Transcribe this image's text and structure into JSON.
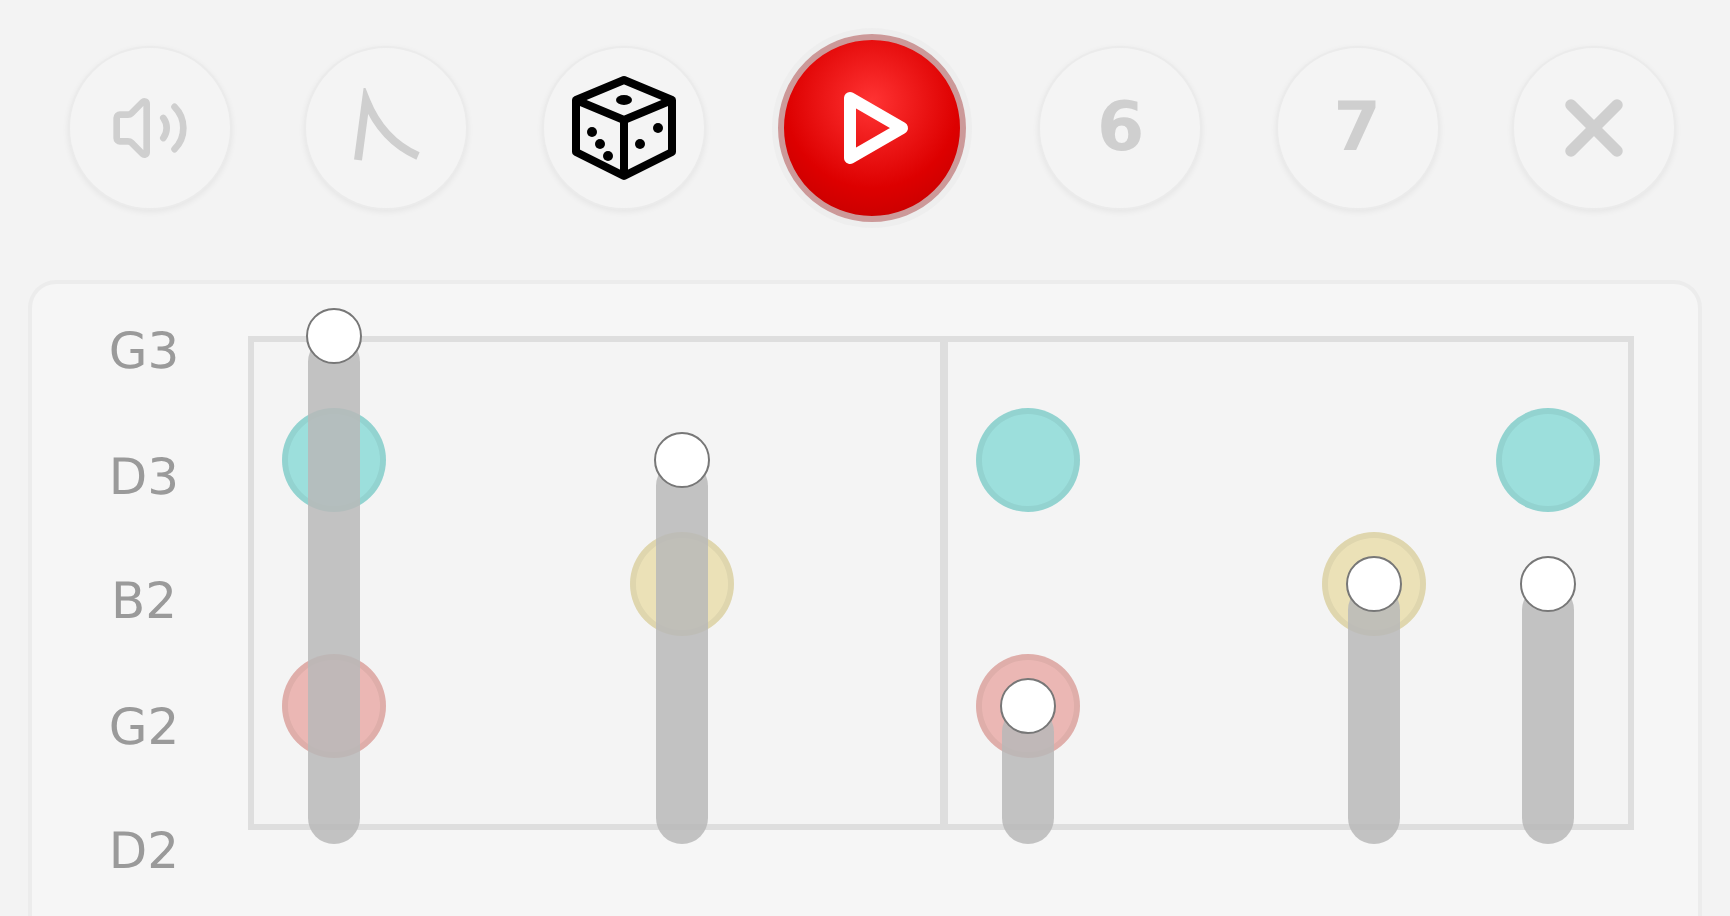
{
  "toolbar": [
    {
      "kind": "sound",
      "disabled": true
    },
    {
      "kind": "decay",
      "disabled": true
    },
    {
      "kind": "dice",
      "disabled": false
    },
    {
      "kind": "play",
      "disabled": false
    },
    {
      "kind": "number",
      "label": "6",
      "disabled": true
    },
    {
      "kind": "number",
      "label": "7",
      "disabled": true
    },
    {
      "kind": "close",
      "disabled": true
    }
  ],
  "grid": {
    "rows": [
      {
        "label": "G3",
        "cells": [
          {
            "handle": true
          },
          null,
          null,
          null,
          null,
          null,
          null,
          null
        ]
      },
      {
        "label": "D3",
        "cells": [
          {
            "color": "#a3e9e6",
            "handle": false
          },
          null,
          {
            "handle": true
          },
          null,
          {
            "color": "#a3e9e6",
            "handle": false
          },
          null,
          null,
          {
            "color": "#a3e9e6",
            "handle": false
          }
        ]
      },
      {
        "label": "B2",
        "cells": [
          null,
          null,
          {
            "color": "#f6ecc0",
            "handle": false
          },
          null,
          null,
          null,
          {
            "color": "#f6ecc0",
            "handle": true
          },
          {
            "handle": true
          }
        ]
      },
      {
        "label": "G2",
        "cells": [
          {
            "color": "#f6c0bc",
            "handle": false
          },
          null,
          null,
          null,
          {
            "color": "#f6c0bc",
            "handle": true
          },
          null,
          null,
          null
        ]
      },
      {
        "label": "D2",
        "cells": [
          null,
          null,
          null,
          null,
          null,
          null,
          null,
          null
        ]
      }
    ]
  }
}
